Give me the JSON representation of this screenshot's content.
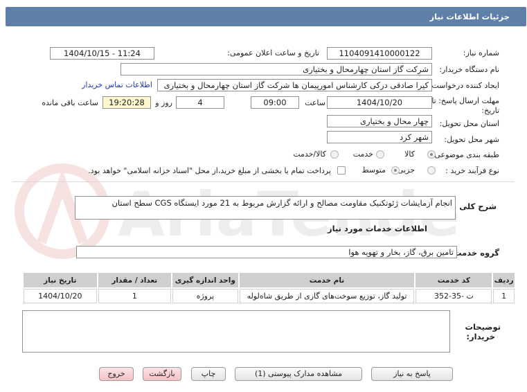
{
  "header": {
    "title": "جزئیات اطلاعات نیاز"
  },
  "need": {
    "number_label": "شماره نیاز:",
    "number_value": "1104091410000122",
    "announce_label": "تاریخ و ساعت اعلان عمومی:",
    "announce_value": "1404/10/15 - 11:24",
    "buyer_label": "نام دستگاه خریدار:",
    "buyer_value": "شرکت گاز استان چهارمحال و بختیاری",
    "creator_label": "ایجاد کننده درخواست:",
    "creator_value": "کیرا صادقی درکی کارشناس امورپیمان ها شرکت گاز استان چهارمحال و بختیاری",
    "contact_link": "اطلاعات تماس خریدار",
    "deadline_label_1": "مهلت ارسال پاسخ: تا",
    "deadline_label_2": "تاریخ:",
    "deadline_date": "1404/10/20",
    "time_label": "ساعت",
    "deadline_time": "09:00",
    "days_value": "4",
    "days_label": "روز و",
    "remaining_time": "19:20:28",
    "remaining_label": "ساعت باقی مانده",
    "province_label": "استان محل تحویل:",
    "province_value": "چهار محال و بختیاری",
    "city_label": "شهر محل تحویل:",
    "city_value": "شهر کرد",
    "category_label": "طبقه بندی موضوعی:",
    "category_options": {
      "goods": "کالا",
      "service": "خدمت",
      "goods_service": "کالا/خدمت"
    },
    "process_label": "نوع فرآیند خرید :",
    "process_options": {
      "partial": "جزیی",
      "medium": "متوسط"
    },
    "payment_note": "پرداخت تمام یا بخشی از مبلغ خرید،از محل \"اسناد خزانه اسلامی\" خواهد بود."
  },
  "description": {
    "label": "شرح کلی نیاز:",
    "value": "انجام آزمایشات ژئوتکنیک  مقاومت مصالح و ارائه گزارش مربوط به 21 مورد ایستگاه CGS سطح استان"
  },
  "services": {
    "section_title": "اطلاعات خدمات مورد نیاز",
    "group_label": "گروه خدمت:",
    "group_value": "تامین برق، گاز، بخار و تهویه هوا",
    "columns": [
      "ردیف",
      "کد خدمت",
      "نام خدمت",
      "واحد اندازه گیری",
      "تعداد / مقدار",
      "تاریخ نیاز"
    ],
    "rows": [
      {
        "index": "1",
        "code": "ت -35-352",
        "name": "تولید گاز، توزیع سوخت‌های گازی از طریق شاه‌لوله",
        "unit": "پروژه",
        "qty": "1",
        "date": "1404/10/20"
      }
    ]
  },
  "buyer_notes": {
    "label_1": "توضیحات",
    "label_2": "خریدار:",
    "value": ""
  },
  "buttons": {
    "reply": "پاسخ به نیاز",
    "attachments": "مشاهده مدارک پیوستی (1)",
    "print": "چاپ",
    "back": "بازگشت",
    "exit": "خروج"
  },
  "watermark": "AriaTender.net",
  "colors": {
    "header": "#5d7fa8",
    "link": "#1a35c9",
    "remaining_bg": "#fff7cf",
    "pink_button": "#f6c2c6",
    "watermark": "#c62828"
  }
}
